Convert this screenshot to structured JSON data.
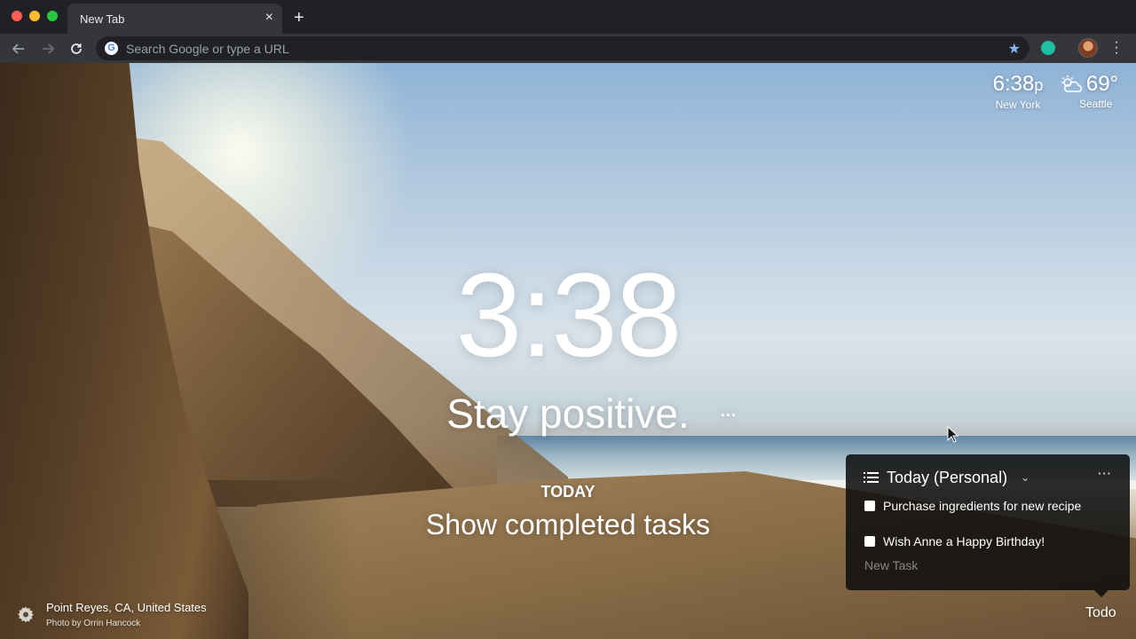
{
  "browser": {
    "tab_title": "New Tab",
    "tab_close": "×",
    "new_tab": "+",
    "omnibox_placeholder": "Search Google or type a URL",
    "google_letter": "G"
  },
  "widgets": {
    "clock_time": "6:38",
    "clock_ampm": "p",
    "clock_city": "New York",
    "weather_temp": "69°",
    "weather_city": "Seattle",
    "weather_icon": "partly-sunny-icon"
  },
  "center": {
    "time": "3:38",
    "mantra": "Stay positive.",
    "mantra_more": "...",
    "focus_label": "TODAY",
    "focus_text": "Show completed tasks"
  },
  "background": {
    "location": "Point Reyes, CA, United States",
    "credit": "Photo by Orrin Hancock"
  },
  "todo": {
    "list_name": "Today (Personal)",
    "more": "···",
    "items": [
      {
        "text": "Purchase ingredients for new recipe",
        "done": false
      },
      {
        "text": "Wish Anne a Happy Birthday!",
        "done": false
      }
    ],
    "new_task_placeholder": "New Task",
    "toggle_label": "Todo"
  },
  "colors": {
    "chrome_dark": "#202124",
    "chrome_toolbar": "#35363a",
    "star_blue": "#8ab4f8",
    "extension_teal": "#1fbfa6"
  }
}
